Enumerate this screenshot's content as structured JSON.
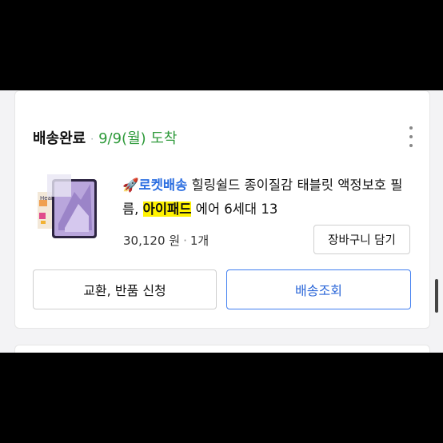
{
  "order": {
    "status": "배송완료",
    "separator": "·",
    "arrival": "9/9(월) 도착",
    "more_icon": "more-vertical-icon"
  },
  "product": {
    "rocket_icon": "🚀",
    "badge": "로켓배송",
    "name_before": " 힐링쉴드 종이질감 태블릿 액정보호 필름, ",
    "name_highlight": "아이패드",
    "name_after": " 에어 6세대 13",
    "price": "30,120 원",
    "price_sep": "·",
    "quantity": "1개",
    "cart_label": "장바구니 담기",
    "thumb_text": "Heal"
  },
  "actions": {
    "exchange_label": "교환, 반품 신청",
    "track_label": "배송조회"
  },
  "colors": {
    "arrival": "#2e9a3a",
    "badge": "#2a6de0",
    "highlight": "#fff200",
    "primary_border": "#3f7ef0"
  }
}
